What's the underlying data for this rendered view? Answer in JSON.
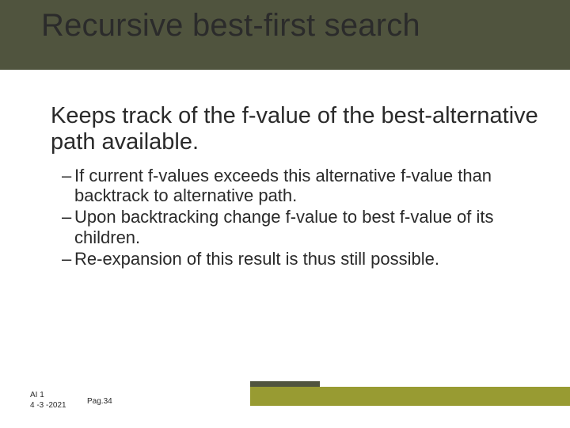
{
  "title": "Recursive best-first search",
  "lead": "Keeps track of the f-value of the best-alternative path available.",
  "bullets": [
    "If current f-values exceeds this alternative f-value than backtrack to alternative path.",
    "Upon backtracking change f-value to best f-value of its children.",
    "Re-expansion of this result is thus still possible."
  ],
  "footer": {
    "course": "AI 1",
    "date": "4 -3 -2021",
    "page": "Pag.34"
  }
}
